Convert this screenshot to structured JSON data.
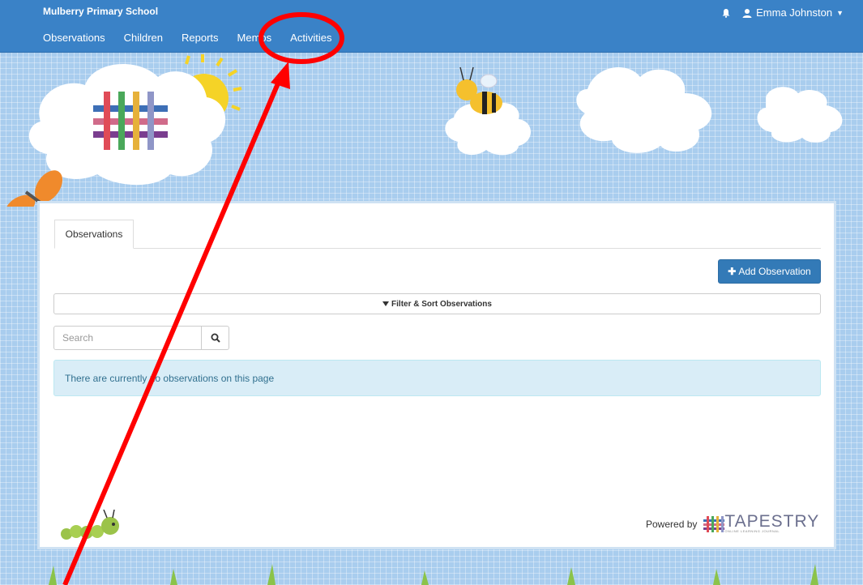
{
  "navbar": {
    "brand": "Mulberry Primary School",
    "links": [
      "Observations",
      "Children",
      "Reports",
      "Memos",
      "Activities"
    ],
    "user_name": "Emma Johnston"
  },
  "panel": {
    "tab_label": "Observations",
    "add_button_label": "Add Observation",
    "filter_label": "Filter & Sort Observations",
    "search_placeholder": "Search",
    "empty_message": "There are currently no observations on this page"
  },
  "footer": {
    "powered_by": "Powered by",
    "logo_word": "TAPESTRY",
    "logo_sub": "ONLINE LEARNING JOURNAL"
  },
  "colors": {
    "navbar": "#3a82c7",
    "primary_button": "#337ab7",
    "info_bg": "#d9edf7",
    "annotation": "#ff0000"
  },
  "icons": [
    "bell-icon",
    "user-icon",
    "plus-icon",
    "filter-icon",
    "search-icon"
  ]
}
